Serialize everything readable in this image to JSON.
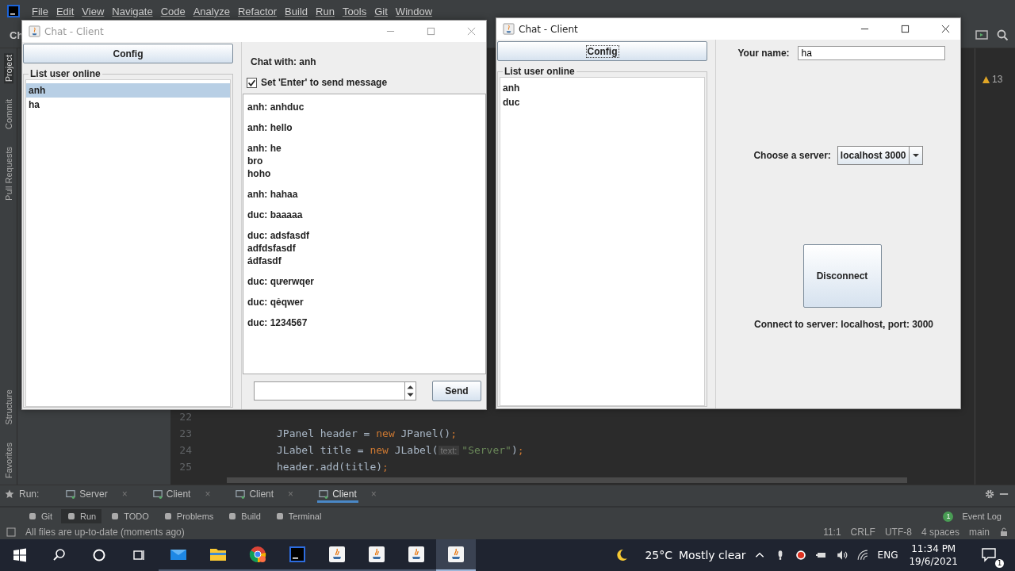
{
  "ide": {
    "menu": [
      "File",
      "Edit",
      "View",
      "Navigate",
      "Code",
      "Analyze",
      "Refactor",
      "Build",
      "Run",
      "Tools",
      "Git",
      "Window"
    ],
    "breadcrumb": "Ch",
    "side_tabs": [
      {
        "label": "Project",
        "selected": true
      },
      {
        "label": "Commit",
        "selected": false
      },
      {
        "label": "Pull Requests",
        "selected": false
      }
    ],
    "side_tabs_bottom": [
      {
        "label": "Structure",
        "selected": false
      },
      {
        "label": "Favorites",
        "selected": false
      }
    ],
    "warnings": "13",
    "code": [
      {
        "number": "22"
      },
      {
        "number": "23",
        "parts": [
          {
            "kind": "plain",
            "text": "JPanel header = "
          },
          {
            "kind": "keyword",
            "text": "new"
          },
          {
            "kind": "plain",
            "text": " JPanel()"
          },
          {
            "kind": "punct",
            "text": ";"
          }
        ]
      },
      {
        "number": "24",
        "parts": [
          {
            "kind": "plain",
            "text": "JLabel title = "
          },
          {
            "kind": "keyword",
            "text": "new"
          },
          {
            "kind": "plain",
            "text": " JLabel("
          },
          {
            "kind": "hint",
            "text": "text:"
          },
          {
            "kind": "string",
            "text": "\"Server\""
          },
          {
            "kind": "plain",
            "text": ")"
          },
          {
            "kind": "punct",
            "text": ";"
          }
        ]
      },
      {
        "number": "25",
        "parts": [
          {
            "kind": "plain",
            "text": "header.add(title)"
          },
          {
            "kind": "punct",
            "text": ";"
          }
        ]
      }
    ],
    "run_label": "Run:",
    "run_tabs": [
      {
        "label": "Server",
        "close": "×",
        "selected": false
      },
      {
        "label": "Client",
        "close": "×",
        "selected": false
      },
      {
        "label": "Client",
        "close": "×",
        "selected": false
      },
      {
        "label": "Client",
        "close": "×",
        "selected": true
      }
    ],
    "tool_tabs": [
      {
        "label": "Git",
        "selected": false
      },
      {
        "label": "Run",
        "selected": true
      },
      {
        "label": "TODO",
        "selected": false
      },
      {
        "label": "Problems",
        "selected": false
      },
      {
        "label": "Build",
        "selected": false
      },
      {
        "label": "Terminal",
        "selected": false
      }
    ],
    "event_log": {
      "label": "Event Log",
      "count": "1"
    },
    "status": "All files are up-to-date (moments ago)",
    "status_right": [
      "11:1",
      "CRLF",
      "UTF-8",
      "4 spaces",
      "main"
    ]
  },
  "windows": [
    {
      "kind": "chat",
      "title": "Chat - Client",
      "active": false,
      "config": "Config",
      "list_title": "List user online",
      "users": [
        {
          "name": "anh",
          "selected": true
        },
        {
          "name": "ha",
          "selected": false
        }
      ],
      "chat_with": "Chat with: anh",
      "enter_to_send": {
        "label": "Set 'Enter' to send message",
        "checked": true
      },
      "messages": [
        {
          "lines": [
            "anh: anhduc"
          ]
        },
        {
          "lines": [
            "anh: hello"
          ]
        },
        {
          "lines": [
            "anh: he",
            "bro",
            "hoho"
          ]
        },
        {
          "lines": [
            "anh: hahaa"
          ]
        },
        {
          "lines": [
            "duc: baaaaa"
          ]
        },
        {
          "lines": [
            "duc: adsfasdf",
            "adfdsfasdf",
            "ádfasdf"
          ]
        },
        {
          "lines": [
            "duc: qưerwqer"
          ]
        },
        {
          "lines": [
            "duc: qẻqwer"
          ]
        },
        {
          "lines": [
            "duc: 1234567"
          ]
        }
      ],
      "send": "Send"
    },
    {
      "kind": "config",
      "title": "Chat - Client",
      "active": true,
      "config": "Config",
      "list_title": "List user online",
      "users": [
        {
          "name": "anh",
          "selected": false
        },
        {
          "name": "duc",
          "selected": false
        }
      ],
      "name_label": "Your name:",
      "name_value": "ha",
      "server_label": "Choose a server:",
      "server_value": "localhost 3000",
      "disconnect": "Disconnect",
      "connection": "Connect to server: localhost, port: 3000"
    }
  ],
  "taskbar": {
    "temperature": "25°C",
    "weather": "Mostly clear",
    "language": "ENG",
    "time": "11:34 PM",
    "date": "19/6/2021",
    "notifications": "1",
    "apps": [
      {
        "kind": "mail",
        "selected": false
      },
      {
        "kind": "folder",
        "selected": false
      },
      {
        "kind": "chrome",
        "selected": false
      },
      {
        "kind": "intellij",
        "selected": false
      },
      {
        "kind": "java",
        "selected": false
      },
      {
        "kind": "java",
        "selected": false
      },
      {
        "kind": "java",
        "selected": false
      },
      {
        "kind": "java",
        "selected": true
      }
    ]
  }
}
